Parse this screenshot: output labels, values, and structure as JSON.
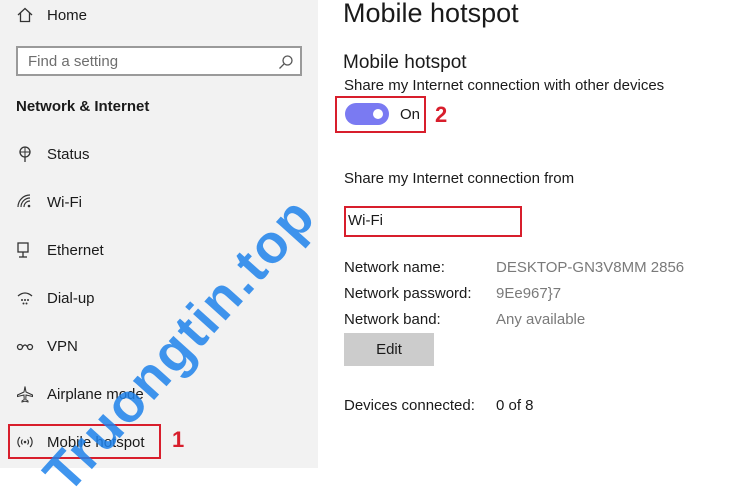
{
  "sidebar": {
    "home": {
      "label": "Home",
      "icon": "home-icon"
    },
    "search": {
      "placeholder": "Find a setting",
      "icon": "search-icon"
    },
    "section": "Network & Internet",
    "items": [
      {
        "label": "Status",
        "icon": "status-icon"
      },
      {
        "label": "Wi-Fi",
        "icon": "wifi-icon"
      },
      {
        "label": "Ethernet",
        "icon": "ethernet-icon"
      },
      {
        "label": "Dial-up",
        "icon": "dialup-icon"
      },
      {
        "label": "VPN",
        "icon": "vpn-icon"
      },
      {
        "label": "Airplane mode",
        "icon": "airplane-icon"
      },
      {
        "label": "Mobile hotspot",
        "icon": "hotspot-icon"
      }
    ]
  },
  "main": {
    "title": "Mobile hotspot",
    "subtitle": "Mobile hotspot",
    "share_label": "Share my Internet connection with other devices",
    "toggle": {
      "state": "On",
      "accent": "#7a7af2"
    },
    "share_from_label": "Share my Internet connection from",
    "share_from_value": "Wi-Fi",
    "fields": [
      {
        "label": "Network name:",
        "value": "DESKTOP-GN3V8MM 2856"
      },
      {
        "label": "Network password:",
        "value": "9Ee967}7"
      },
      {
        "label": "Network band:",
        "value": "Any available"
      }
    ],
    "edit_label": "Edit",
    "devices": {
      "label": "Devices connected:",
      "value": "0 of 8"
    }
  },
  "annotations": {
    "one": "1",
    "two": "2",
    "color": "#d81e2c"
  },
  "watermark": "Truongtin.top"
}
